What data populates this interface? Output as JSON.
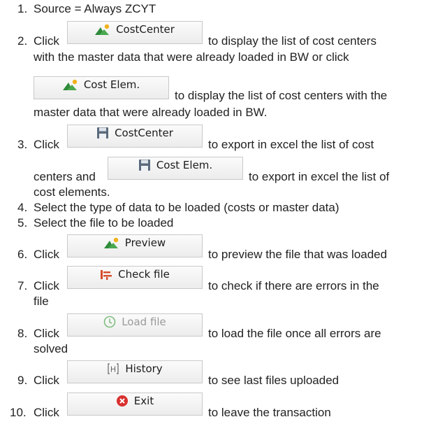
{
  "steps": [
    {
      "num": "1.",
      "lines": [
        "Source = Always ZCYT"
      ]
    },
    {
      "num": "2.",
      "lines": [
        "Click",
        "to display the list of cost centers",
        "with the master data that were already loaded in BW or click",
        "to display the list of cost centers with the",
        "master data that were already loaded in BW."
      ]
    },
    {
      "num": "3.",
      "lines": [
        "Click",
        "to export in excel the list of cost",
        "centers and",
        "to export in excel the list of",
        "cost elements."
      ]
    },
    {
      "num": "4.",
      "lines": [
        "Select the type of data to be loaded (costs or master data)"
      ]
    },
    {
      "num": "5.",
      "lines": [
        "Select the file to be loaded"
      ]
    },
    {
      "num": "6.",
      "lines": [
        "Click",
        "to preview the file that was loaded"
      ]
    },
    {
      "num": "7.",
      "lines": [
        "Click",
        "to check if there are errors in the",
        "file"
      ]
    },
    {
      "num": "8.",
      "lines": [
        "Click",
        "to load the file once all errors are",
        "solved"
      ]
    },
    {
      "num": "9.",
      "lines": [
        "Click",
        "to see last files uploaded"
      ]
    },
    {
      "num": "10.",
      "lines": [
        "Click",
        "to leave the transaction"
      ]
    }
  ],
  "buttons": {
    "costcenter_display": {
      "label": "CostCenter",
      "icon": "mountain-sun-icon"
    },
    "costelem_display": {
      "label": "Cost Elem.",
      "icon": "mountain-sun-icon"
    },
    "costcenter_export": {
      "label": "CostCenter",
      "icon": "save-icon"
    },
    "costelem_export": {
      "label": "Cost Elem.",
      "icon": "save-icon"
    },
    "preview": {
      "label": "Preview",
      "icon": "mountain-sun-icon"
    },
    "check_file": {
      "label": "Check file",
      "icon": "check-file-icon"
    },
    "load_file": {
      "label": "Load file",
      "icon": "load-clock-icon"
    },
    "history": {
      "label": "History",
      "icon": "history-h-icon"
    },
    "exit": {
      "label": "Exit",
      "icon": "exit-x-icon"
    }
  }
}
